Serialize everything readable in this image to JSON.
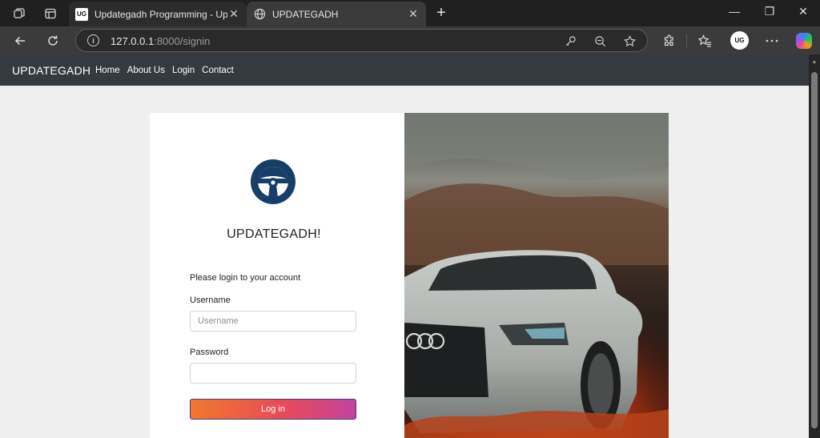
{
  "browser": {
    "tabs": [
      {
        "title": "Updategadh Programming - Upd",
        "favicon": "UG",
        "active": false
      },
      {
        "title": "UPDATEGADH",
        "favicon": "globe-icon",
        "active": true
      }
    ],
    "url_host": "127.0.0.1",
    "url_rest": ":8000/signin",
    "profile_initials": "UG"
  },
  "site": {
    "brand": "UPDATEGADH",
    "nav": [
      "Home",
      "About Us",
      "Login",
      "Contact"
    ]
  },
  "login": {
    "title": "UPDATEGADH!",
    "prompt": "Please login to your account",
    "username_label": "Username",
    "username_placeholder": "Username",
    "username_value": "",
    "password_label": "Password",
    "password_value": "",
    "button_label": "Log in"
  },
  "colors": {
    "site_nav_bg": "#343a40",
    "logo_color": "#173e66",
    "button_gradient": [
      "#f0792e",
      "#e94a55",
      "#c2449f"
    ]
  }
}
